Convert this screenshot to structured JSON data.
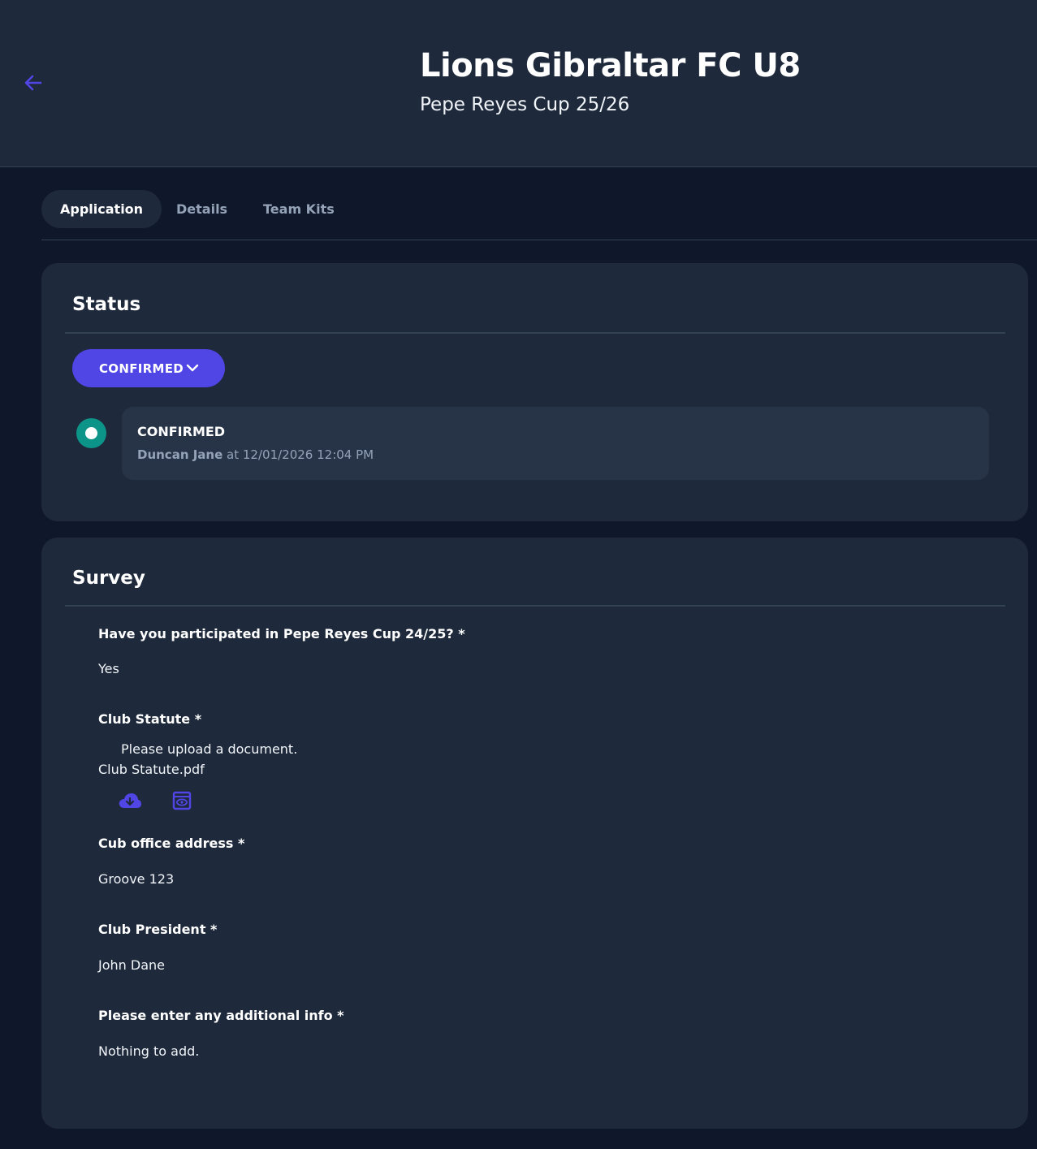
{
  "header": {
    "title": "Lions Gibraltar FC U8",
    "subtitle": "Pepe Reyes Cup 25/26",
    "back_icon": "arrow-left-icon"
  },
  "tabs": [
    {
      "label": "Application",
      "active": true
    },
    {
      "label": "Details",
      "active": false
    },
    {
      "label": "Team Kits",
      "active": false
    }
  ],
  "status": {
    "title": "Status",
    "dropdown_value": "CONFIRMED",
    "timeline": {
      "status": "CONFIRMED",
      "user": "Duncan Jane",
      "meta_suffix": " at 12/01/2026 12:04 PM"
    }
  },
  "survey": {
    "title": "Survey",
    "questions": [
      {
        "label": "Have you participated in Pepe Reyes Cup 24/25? *",
        "answer": "Yes"
      },
      {
        "label": "Club Statute *",
        "hint": "Please upload a document.",
        "file_name": "Club Statute.pdf"
      },
      {
        "label": "Cub office address *",
        "answer": "Groove 123"
      },
      {
        "label": "Club President *",
        "answer": "John Dane"
      },
      {
        "label": "Please enter any additional info *",
        "answer": "Nothing to add."
      }
    ]
  },
  "colors": {
    "accent": "#4f46e5",
    "success": "#0d9488",
    "background": "#0f172a",
    "surface": "#1e293b"
  }
}
